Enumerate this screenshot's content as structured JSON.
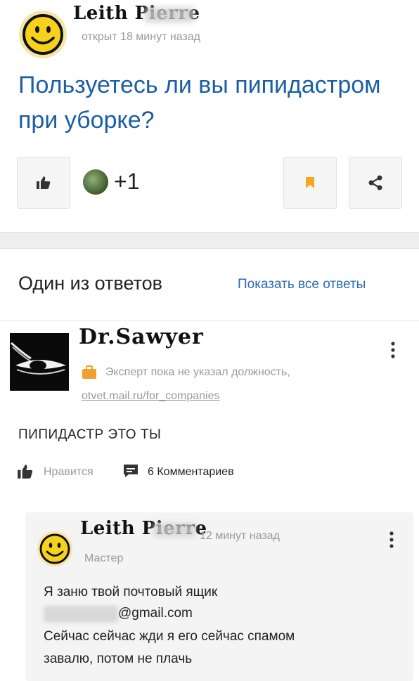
{
  "question": {
    "author": "Leith Pierre",
    "meta": "открыт 18 минут назад",
    "title": "Пользуетесь ли вы пипидастром при уборке?",
    "like_count": "+1"
  },
  "answers_section": {
    "heading": "Один из ответов",
    "show_all": "Показать все ответы"
  },
  "answer": {
    "author": "Dr.Sawyer",
    "role": "Эксперт пока не указал должность,",
    "link": "otvet.mail.ru/for_companies",
    "text": "ПИПИДАСТР ЭТО ТЫ",
    "like_label": "Нравится",
    "comments": "6  Комментариев"
  },
  "comment": {
    "author": "Leith Pierre",
    "time": "12 минут назад",
    "role": "Мастер",
    "line1": "Я заню твой почтовый ящик",
    "line2": "@gmail.com",
    "line3": "Сейчас сейчас жди я его сейчас спамом",
    "line4": "завалю, потом не плачь"
  },
  "colors": {
    "link_blue": "#1a5ea8",
    "bookmark_orange": "#f5a623",
    "briefcase_orange": "#f0a030",
    "smiley_yellow": "#f7d21c"
  },
  "icons": [
    "thumbs-up-icon",
    "bookmark-icon",
    "share-icon",
    "briefcase-icon",
    "kebab-menu-icon",
    "comment-icon",
    "smiley-avatar"
  ]
}
